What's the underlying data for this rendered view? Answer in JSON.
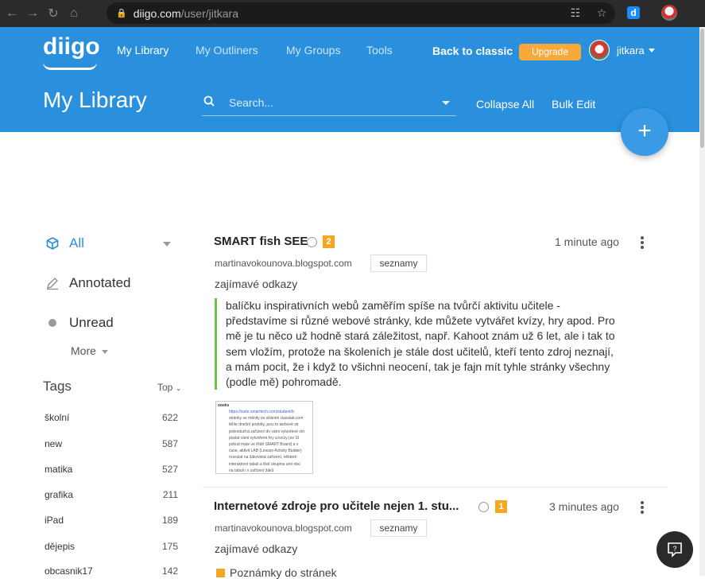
{
  "browser": {
    "url_host": "diigo.com",
    "url_path": "/user/jitkara",
    "ext_label": "d",
    "icons": [
      "back-icon",
      "forward-icon",
      "reload-icon",
      "home-icon",
      "lock-icon",
      "translate-icon",
      "star-icon",
      "extension-icon",
      "profile-icon"
    ]
  },
  "header": {
    "logo": "diigo",
    "nav": [
      "My Library",
      "My Outliners",
      "My Groups",
      "Tools"
    ],
    "back_classic": "Back to classic",
    "upgrade": "Upgrade",
    "username": "jitkara",
    "page_title": "My Library",
    "search_placeholder": "Search...",
    "collapse_all": "Collapse All",
    "bulk_edit": "Bulk Edit",
    "fab": "+"
  },
  "sidebar": {
    "filters": [
      "All",
      "Annotated",
      "Unread"
    ],
    "more": "More",
    "tags_title": "Tags",
    "tags_sort": "Top",
    "tags": [
      {
        "name": "školní",
        "count": "622"
      },
      {
        "name": "new",
        "count": "587"
      },
      {
        "name": "matika",
        "count": "527"
      },
      {
        "name": "grafika",
        "count": "211"
      },
      {
        "name": "iPad",
        "count": "189"
      },
      {
        "name": "dějepis",
        "count": "175"
      },
      {
        "name": "obcasnik17",
        "count": "142"
      }
    ]
  },
  "items": [
    {
      "title": "SMART fish SEE",
      "badge": "2",
      "time": "1 minute ago",
      "domain": "martinavokounova.blogspot.com",
      "tag": "seznamy",
      "description": "zajímavé odkazy",
      "highlight": [
        "balíčku inspirativních webů zaměřím spíše na tvůrčí aktivitu učitele -",
        "představíme si různé webové stránky, kde můžete vytvářet kvízy, hry apod. Pro",
        "mě je tu něco už hodně stará záležitost, např. Kahoot znám už 6 let, ale i tak to",
        "sem vložím, protože na školeních je stále dost učitelů, kteří tento zdroj neznají,",
        "a mám pocit, že i když to všichni neocení, tak je fajn mít tyhle stránky všechny",
        "(podle mě) pohromadě."
      ],
      "thumb_lines": [
        "https://suite.smarttech.com/student/lc",
        "stránky se měnily ze stránek classlab.com",
        "téhle dnešní podoby, jsou to webové str",
        "jednoduchá zařízení do vámi vytvořené virt",
        "poslat vámi vytvořené hry a kvízy (ze SI",
        "pokud máte ve třídě SMART Board) a s",
        "čase, aktivit LAB (Lesson Activity Builder)",
        "rozeslat na žákovská zařízení, některé",
        "interaktivní tabuli a třetí skupina umí obo",
        "na tabuli i v zařízení žáků"
      ],
      "thumb_header": "ooeks"
    },
    {
      "title": "Internetové zdroje pro učitele nejen 1. stu...",
      "badge": "1",
      "time": "3 minutes ago",
      "domain": "martinavokounova.blogspot.com",
      "tag": "seznamy",
      "description": "zajímavé odkazy",
      "note": "Poznámky do stránek"
    }
  ],
  "colors": {
    "brand": "#2a90dd",
    "upgrade": "#f7a93b",
    "badge": "#f5a623",
    "highlight_bar": "#6cc04a"
  }
}
